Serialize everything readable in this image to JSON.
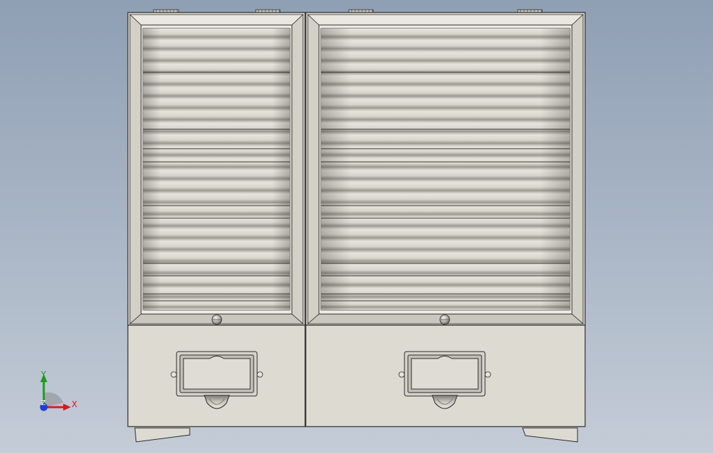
{
  "viewport": {
    "background_top": "#8f9fb4",
    "background_bottom": "#c4ccd7"
  },
  "model": {
    "type": "two-bay roll-shutter cabinet with drawers",
    "body_color": "#dcdad1",
    "edge_color": "#2a2a2a",
    "bays": [
      {
        "id": "left",
        "shutter_slats": "horizontal",
        "knob": "shutter-knob",
        "drawer": "drawer-with-label-holder-and-cup-pull"
      },
      {
        "id": "right",
        "shutter_slats": "horizontal",
        "knob": "shutter-knob",
        "drawer": "drawer-with-label-holder-and-cup-pull"
      }
    ]
  },
  "triad": {
    "x_label": "X",
    "y_label": "Y",
    "z_label": "Z",
    "x_color": "#d21c1c",
    "y_color": "#1f9a1f",
    "z_color": "#1f3fd6"
  }
}
